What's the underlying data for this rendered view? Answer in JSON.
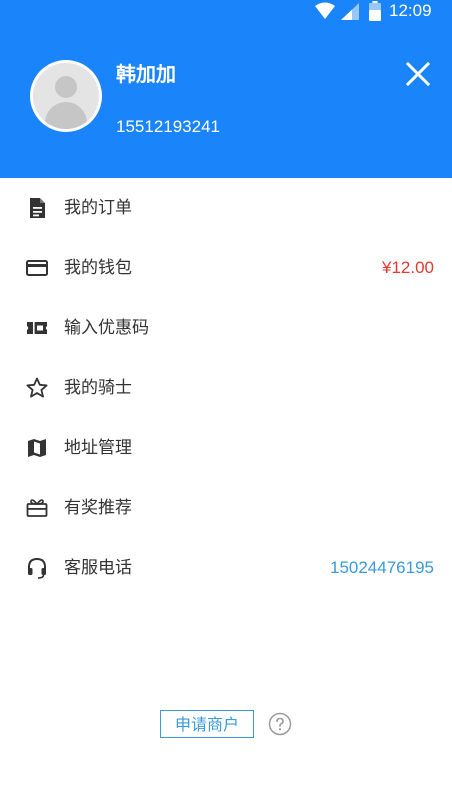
{
  "status_bar": {
    "time": "12:09",
    "icons": [
      "wifi-icon",
      "cell-signal-icon",
      "battery-icon"
    ]
  },
  "profile": {
    "name": "韩加加",
    "phone": "15512193241",
    "avatar_icon": "default-avatar-icon",
    "close_icon": "close-icon"
  },
  "menu": {
    "items": [
      {
        "label": "我的订单",
        "icon": "document-icon"
      },
      {
        "label": "我的钱包",
        "icon": "wallet-card-icon",
        "value": "¥12.00"
      },
      {
        "label": "输入优惠码",
        "icon": "coupon-ticket-icon"
      },
      {
        "label": "我的骑士",
        "icon": "star-outline-icon"
      },
      {
        "label": "地址管理",
        "icon": "map-icon"
      },
      {
        "label": "有奖推荐",
        "icon": "gift-icon"
      },
      {
        "label": "客服电话",
        "icon": "headset-icon",
        "value": "15024476195"
      }
    ]
  },
  "footer": {
    "apply_label": "申请商户",
    "help_icon": "help-circle-icon"
  },
  "colors": {
    "header_bg": "#1a84fb",
    "wallet_value": "#e8382e",
    "phone_value": "#3a9bd9",
    "apply_border": "#3a9bd9",
    "icon": "#333333"
  }
}
